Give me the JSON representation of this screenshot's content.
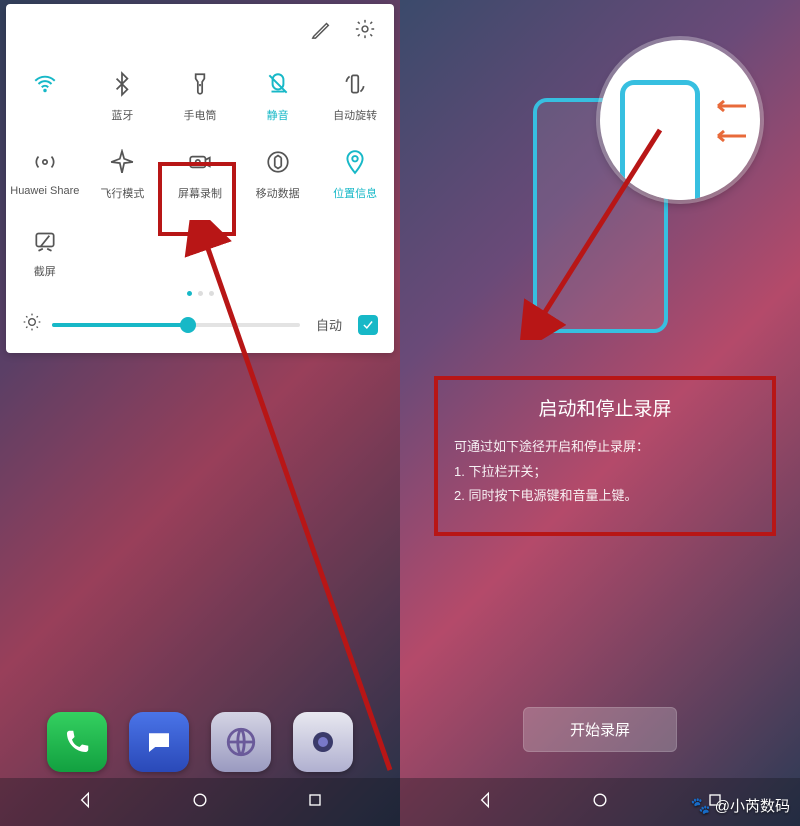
{
  "accent_color": "#17b8c7",
  "highlight_color": "#b81616",
  "quick_settings": {
    "row1": [
      {
        "name": "wifi",
        "label": "",
        "active": true
      },
      {
        "name": "bluetooth",
        "label": "蓝牙",
        "active": false
      },
      {
        "name": "torch",
        "label": "手电筒",
        "active": false
      },
      {
        "name": "mute",
        "label": "静音",
        "active": true
      },
      {
        "name": "rotate",
        "label": "自动旋转",
        "active": false
      }
    ],
    "row2": [
      {
        "name": "huawei-share",
        "label": "Huawei Share",
        "active": false
      },
      {
        "name": "airplane",
        "label": "飞行模式",
        "active": false
      },
      {
        "name": "screen-record",
        "label": "屏幕录制",
        "active": false
      },
      {
        "name": "mobile-data",
        "label": "移动数据",
        "active": false
      },
      {
        "name": "location",
        "label": "位置信息",
        "active": true
      }
    ],
    "row3": [
      {
        "name": "screenshot",
        "label": "截屏",
        "active": false
      }
    ],
    "brightness": {
      "auto_label": "自动",
      "auto_checked": true,
      "percent": 55
    }
  },
  "tutorial": {
    "title": "启动和停止录屏",
    "intro": "可通过如下途径开启和停止录屏：",
    "step1": "1. 下拉栏开关；",
    "step2": "2. 同时按下电源键和音量上键。",
    "start_button": "开始录屏"
  },
  "watermark": "@小芮数码"
}
